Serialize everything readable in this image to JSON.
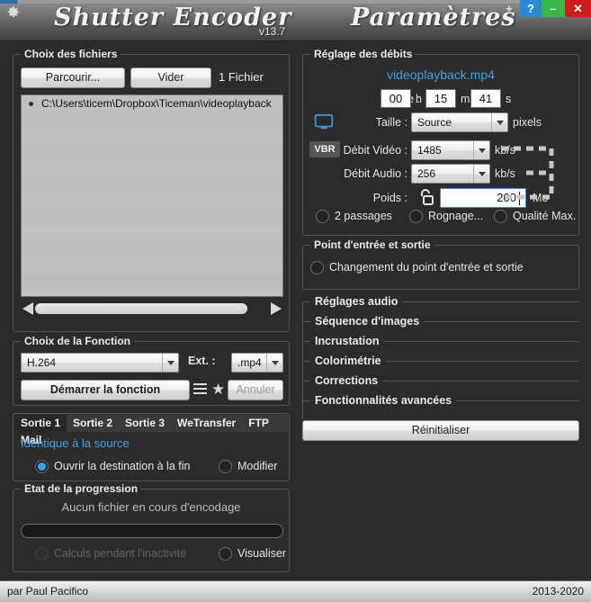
{
  "titlebar": {
    "gear_icon": "gear-icon",
    "app_title": "Shutter Encoder",
    "version": "v13.7",
    "params_title": "Paramètres",
    "buttons": {
      "plus": "+",
      "help": "?",
      "minimize": "–",
      "close": "✕"
    },
    "colors": {
      "help_bg": "#2a89d4",
      "minimize_bg": "#39b54a",
      "close_bg": "#cf1b1b"
    }
  },
  "files": {
    "legend": "Choix des fichiers",
    "browse_label": "Parcourir...",
    "clear_label": "Vider",
    "count_label": "1 Fichier",
    "items": [
      {
        "path": "C:\\Users\\ticem\\Dropbox\\Ticeman\\videoplayback"
      }
    ],
    "scroll_left_icon": "arrow-left-icon",
    "scroll_right_icon": "arrow-right-icon"
  },
  "function": {
    "legend": "Choix de la Fonction",
    "codec_value": "H.264",
    "ext_label": "Ext. :",
    "ext_value": ".mp4",
    "start_label": "Démarrer la fonction",
    "list_icon": "list-icon",
    "star_icon": "star-icon",
    "cancel_label": "Annuler"
  },
  "output": {
    "tabs": [
      {
        "label": "Sortie 1",
        "active": true
      },
      {
        "label": "Sortie 2",
        "active": false
      },
      {
        "label": "Sortie 3",
        "active": false
      },
      {
        "label": "WeTransfer",
        "active": false
      },
      {
        "label": "FTP",
        "active": false
      },
      {
        "label": "Mail",
        "active": false
      }
    ],
    "mode_text": "Identique à la source",
    "open_dest_label": "Ouvrir la destination à la fin",
    "open_dest_checked": true,
    "modify_label": "Modifier",
    "modify_checked": false,
    "accent_color": "#4a9fe0"
  },
  "progress": {
    "legend": "Etat de la progression",
    "message": "Aucun fichier en cours d'encodage",
    "percent": 0,
    "idle_calc_label": "Calculs pendant l'inactivité",
    "idle_calc_checked": false,
    "visualize_label": "Visualiser",
    "visualize_checked": false
  },
  "bitrate": {
    "legend": "Réglage des débits",
    "media_name": "videoplayback.mp4",
    "duration_label": "Durée :",
    "duration": {
      "hours": "00",
      "minutes": "15",
      "seconds": "41"
    },
    "unit_h": "h",
    "unit_m": "m",
    "unit_s": "s",
    "monitor_icon": "monitor-icon",
    "size_label": "Taille :",
    "size_value": "Source",
    "size_unit": "pixels",
    "vbr_badge": "VBR",
    "video_rate_label": "Débit Vidéo :",
    "video_rate_value": "1485",
    "video_rate_unit": "kb/s",
    "audio_rate_label": "Débit Audio :",
    "audio_rate_value": "256",
    "audio_rate_unit": "kb/s",
    "weight_label": "Poids :",
    "lock_icon": "unlock-icon",
    "weight_value": "200",
    "weight_unit": "Mo",
    "options": [
      {
        "label": "2 passages",
        "checked": false
      },
      {
        "label": "Rognage...",
        "checked": false
      },
      {
        "label": "Qualité Max.",
        "checked": false
      }
    ]
  },
  "inout": {
    "legend": "Point d'entrée et sortie",
    "change_label": "Changement du point d'entrée et sortie",
    "change_checked": false
  },
  "sections": [
    {
      "title": "Réglages audio"
    },
    {
      "title": "Séquence d'images"
    },
    {
      "title": "Incrustation"
    },
    {
      "title": "Colorimétrie"
    },
    {
      "title": "Corrections"
    },
    {
      "title": "Fonctionnalités avancées"
    }
  ],
  "reset_label": "Réinitialiser",
  "footer": {
    "author": "par Paul Pacifico",
    "years": "2013-2020"
  }
}
